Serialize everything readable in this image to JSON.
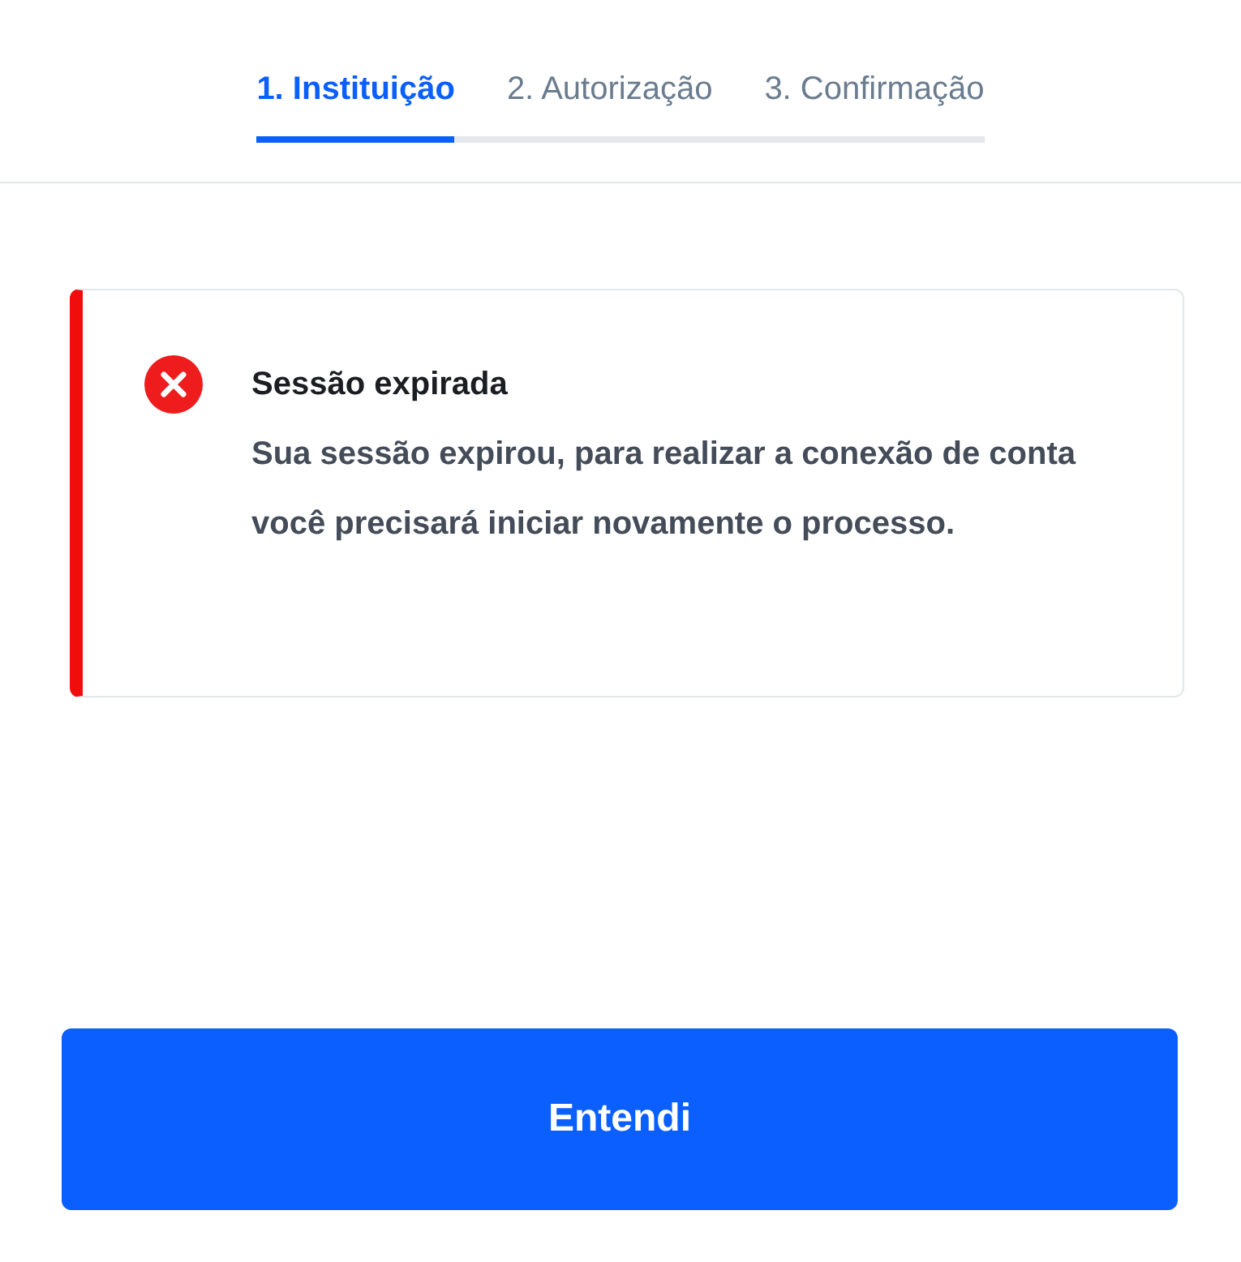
{
  "steps": [
    {
      "label": "1. Instituição",
      "selected": true
    },
    {
      "label": "2. Autorização",
      "selected": false
    },
    {
      "label": "3. Confirmação",
      "selected": false
    }
  ],
  "alert": {
    "kind": "error",
    "title": "Sessão expirada",
    "message": "Sua sessão expirou, para realizar a conexão de conta você precisará iniciar novamente o processo."
  },
  "button": {
    "label": "Entendi"
  }
}
